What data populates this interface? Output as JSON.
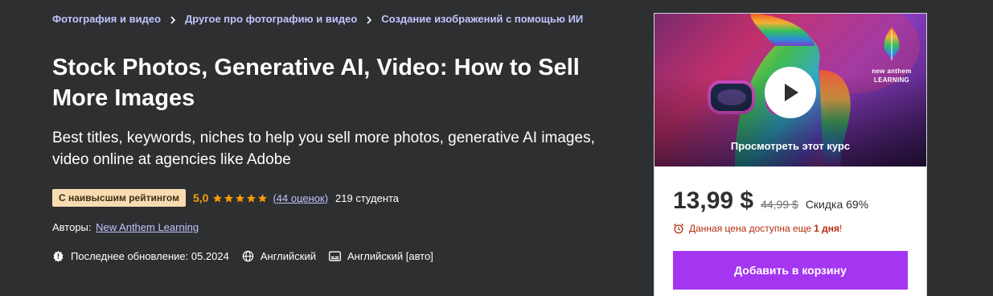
{
  "breadcrumb": [
    {
      "label": "Фотография и видео"
    },
    {
      "label": "Другое про фотографию и видео"
    },
    {
      "label": "Создание изображений с помощью ИИ"
    }
  ],
  "course": {
    "title": "Stock Photos, Generative AI, Video: How to Sell More Images",
    "subtitle": "Best titles, keywords, niches to help you sell more photos, generative AI images, video online at agencies like Adobe",
    "badge": "С наивысшим рейтингом",
    "rating": "5,0",
    "stars": 5,
    "reviews": "(44 оценок)",
    "students": "219 студента",
    "authors_label": "Авторы:",
    "author": "New Anthem Learning",
    "last_updated": "Последнее обновление: 05.2024",
    "language": "Английский",
    "captions": "Английский [авто]"
  },
  "sidebar": {
    "preview_label": "Просмотреть этот курс",
    "brand_line1": "new anthem",
    "brand_line2": "LEARNING",
    "price": "13,99 $",
    "old_price": "44,99 $",
    "discount": "Скидка 69%",
    "timer_text": "Данная цена доступна еще",
    "timer_bold": "1 дня",
    "timer_end": "!",
    "cart_button": "Добавить в корзину"
  },
  "colors": {
    "background": "#2d2f31",
    "link": "#c0c4fc",
    "star": "#f69c08",
    "badge_bg": "#f8dbb1",
    "cta": "#a435f0",
    "timer": "#b32d0f"
  },
  "icons": [
    "chevron-right-icon",
    "star-icon",
    "update-alert-icon",
    "globe-icon",
    "captions-icon",
    "play-icon",
    "alarm-clock-icon"
  ]
}
